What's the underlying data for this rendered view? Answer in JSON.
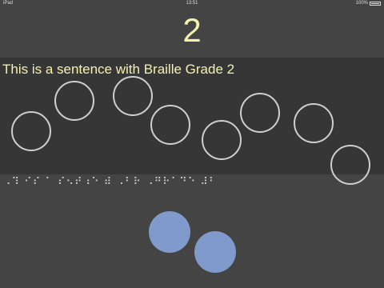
{
  "status_bar": {
    "carrier": "iPad",
    "time": "13:51",
    "battery": "100%"
  },
  "level": {
    "number": "2"
  },
  "sentence": {
    "text": "This is a sentence with Braille Grade 2"
  },
  "braille_line": {
    "text": "⠠⠹ ⠊⠎ ⠁ ⠎⠢⠞⠰⠑ ⠾ ⠠⠃⠗ ⠠⠛⠗⠁⠙⠑ ⠼⠃"
  },
  "colors": {
    "background": "#444444",
    "panel": "#363636",
    "text": "#f5f2b0",
    "circle_outline": "#cfcfcf",
    "key_fill": "#7f9acb"
  }
}
